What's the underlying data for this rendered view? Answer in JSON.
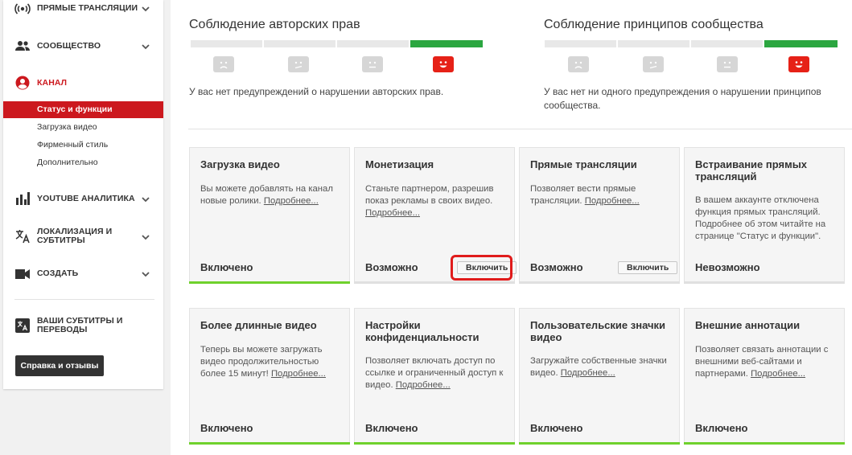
{
  "sidebar": {
    "nav": [
      {
        "label": "Прямые трансляции",
        "icon": "live-broadcast-icon"
      },
      {
        "label": "Сообщество",
        "icon": "people-icon"
      },
      {
        "label": "Канал",
        "icon": "account-circle-icon",
        "active": true
      },
      {
        "label": "YouTube Аналитика",
        "icon": "bar-chart-icon"
      },
      {
        "label_line1": "Локализация и",
        "label_line2": "субтитры",
        "icon": "translate-icon"
      },
      {
        "label": "Создать",
        "icon": "video-camera-icon"
      }
    ],
    "channel_sub": [
      {
        "label": "Статус и функции",
        "active": true
      },
      {
        "label": "Загрузка видео"
      },
      {
        "label": "Фирменный стиль"
      },
      {
        "label": "Дополнительно"
      }
    ],
    "subtitles_line1": "Ваши субтитры и",
    "subtitles_line2": "переводы",
    "help_button": "Справка и отзывы"
  },
  "copyright": {
    "title": "Соблюдение авторских прав",
    "description": "У вас нет предупреждений о нарушении авторских прав.",
    "level": 4
  },
  "community": {
    "title": "Соблюдение принципов сообщества",
    "description": "У вас нет ни одного предупреждения о нарушении принципов сообщества.",
    "level": 4
  },
  "colors": {
    "accent_red": "#cc181e",
    "status_green": "#6fd12c",
    "strike_green": "#2ba640",
    "highlight": "#e01b1b"
  },
  "cards": [
    {
      "title": "Загрузка видео",
      "desc": "Вы можете добавлять на канал новые ролики.",
      "link": "Подробнее...",
      "status": "Включено"
    },
    {
      "title": "Монетизация",
      "desc": "Станьте партнером, разрешив показ рекламы в своих видео.",
      "link": "Подробнее...",
      "status": "Возможно",
      "button": "Включить"
    },
    {
      "title": "Прямые трансляции",
      "desc": "Позволяет вести прямые трансляции.",
      "link": "Подробнее...",
      "status": "Возможно",
      "button": "Включить"
    },
    {
      "title": "Встраивание прямых трансляций",
      "desc": "В вашем аккаунте отключена функция прямых трансляций. Подробнее об этом читайте на странице \"Статус и функции\".",
      "status": "Невозможно"
    },
    {
      "title": "Более длинные видео",
      "desc": "Теперь вы можете загружать видео продолжительностью более 15 минут!",
      "link": "Подробнее...",
      "status": "Включено"
    },
    {
      "title": "Настройки конфиденциальности",
      "desc": "Позволяет включать доступ по ссылке и ограниченный доступ к видео.",
      "link": "Подробнее...",
      "status": "Включено"
    },
    {
      "title": "Пользовательские значки видео",
      "desc": "Загружайте собственные значки видео.",
      "link": "Подробнее...",
      "status": "Включено"
    },
    {
      "title": "Внешние аннотации",
      "desc": "Позволяет связать аннотации с внешними веб-сайтами и партнерами.",
      "link": "Подробнее...",
      "status": "Включено"
    }
  ]
}
